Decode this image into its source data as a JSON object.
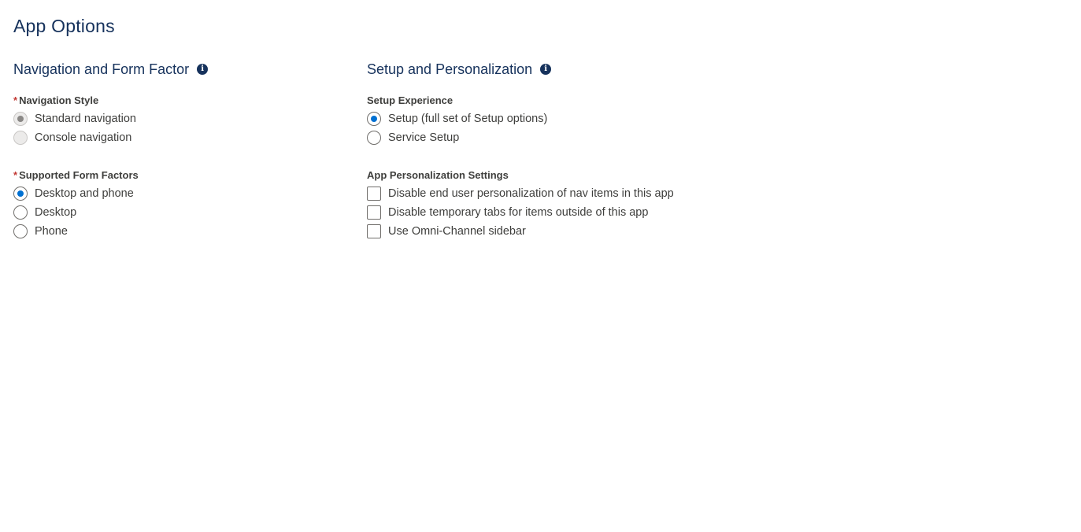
{
  "page": {
    "title": "App Options"
  },
  "navigation_form_factor": {
    "title": "Navigation and Form Factor",
    "info_icon": "info-icon",
    "navigation_style": {
      "label": "Navigation Style",
      "required_marker": "*",
      "options": [
        {
          "label": "Standard navigation",
          "checked": true,
          "disabled": true
        },
        {
          "label": "Console navigation",
          "checked": false,
          "disabled": true
        }
      ]
    },
    "supported_form_factors": {
      "label": "Supported Form Factors",
      "required_marker": "*",
      "options": [
        {
          "label": "Desktop and phone",
          "checked": true,
          "disabled": false
        },
        {
          "label": "Desktop",
          "checked": false,
          "disabled": false
        },
        {
          "label": "Phone",
          "checked": false,
          "disabled": false
        }
      ]
    }
  },
  "setup_personalization": {
    "title": "Setup and Personalization",
    "info_icon": "info-icon",
    "setup_experience": {
      "label": "Setup Experience",
      "options": [
        {
          "label": "Setup (full set of Setup options)",
          "checked": true
        },
        {
          "label": "Service Setup",
          "checked": false
        }
      ]
    },
    "app_personalization": {
      "label": "App Personalization Settings",
      "checkboxes": [
        {
          "label": "Disable end user personalization of nav items in this app",
          "checked": false
        },
        {
          "label": "Disable temporary tabs for items outside of this app",
          "checked": false
        },
        {
          "label": "Use Omni-Channel sidebar",
          "checked": false
        }
      ]
    }
  },
  "colors": {
    "title": "#16325c",
    "accent": "#0070d2",
    "required": "#c23934",
    "text": "#3e3e3c"
  }
}
